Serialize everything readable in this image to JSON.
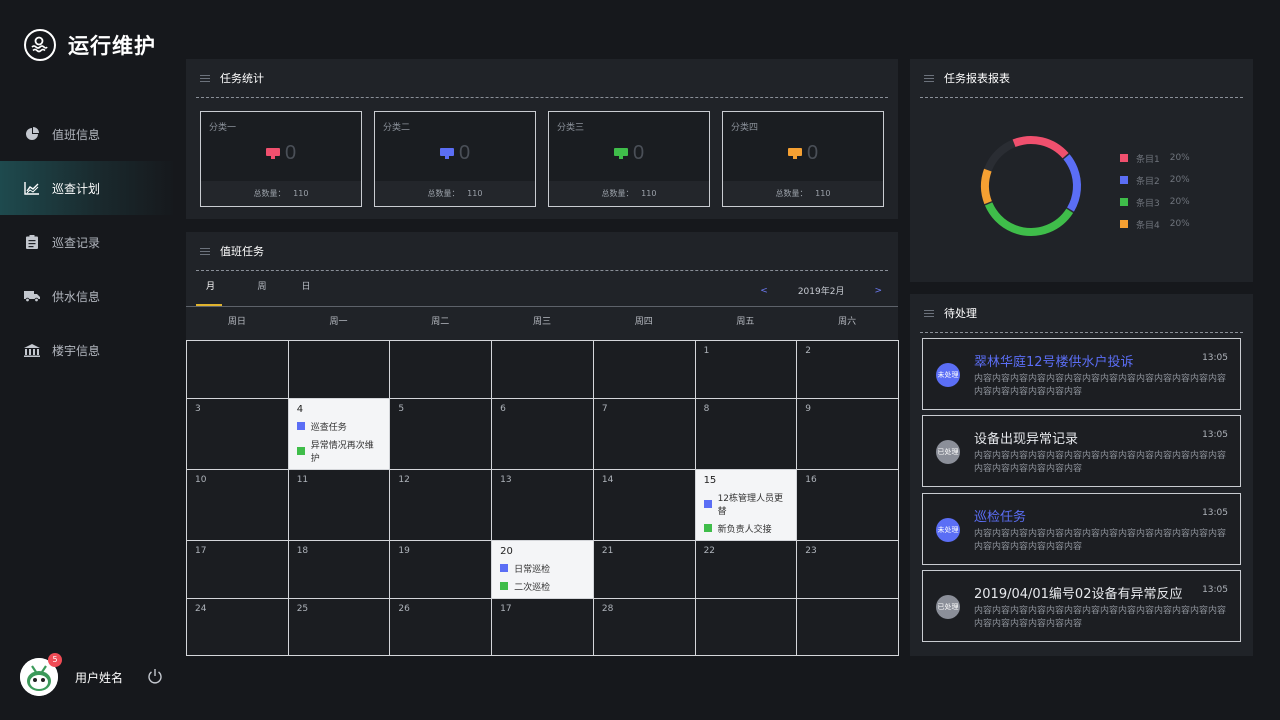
{
  "app": {
    "title": "运行维护"
  },
  "sidebar": {
    "items": [
      {
        "label": "值班信息",
        "icon": "pie-chart-icon",
        "active": false
      },
      {
        "label": "巡查计划",
        "icon": "line-chart-icon",
        "active": true
      },
      {
        "label": "巡查记录",
        "icon": "clipboard-icon",
        "active": false
      },
      {
        "label": "供水信息",
        "icon": "truck-icon",
        "active": false
      },
      {
        "label": "楼宇信息",
        "icon": "building-icon",
        "active": false
      }
    ]
  },
  "user": {
    "name": "用户姓名",
    "badge": "5"
  },
  "task_stats": {
    "title": "任务统计",
    "cards": [
      {
        "category": "分类一",
        "count": "0",
        "total_label": "总数量：",
        "total": "110",
        "color": "#f0506e"
      },
      {
        "category": "分类二",
        "count": "0",
        "total_label": "总数量：",
        "total": "110",
        "color": "#5b6ef5"
      },
      {
        "category": "分类三",
        "count": "0",
        "total_label": "总数量：",
        "total": "110",
        "color": "#3fbd4a"
      },
      {
        "category": "分类四",
        "count": "0",
        "total_label": "总数量：",
        "total": "110",
        "color": "#f5a032"
      }
    ]
  },
  "duty": {
    "title": "值班任务",
    "tabs": [
      "月",
      "周",
      "日"
    ],
    "active_tab": "月",
    "month": "2019年2月",
    "prev": "<",
    "next": ">",
    "weekdays": [
      "周日",
      "周一",
      "周二",
      "周三",
      "周四",
      "周五",
      "周六"
    ],
    "cells": [
      {
        "d": ""
      },
      {
        "d": ""
      },
      {
        "d": ""
      },
      {
        "d": ""
      },
      {
        "d": ""
      },
      {
        "d": "1"
      },
      {
        "d": "2"
      },
      {
        "d": "3"
      },
      {
        "d": "4",
        "events": [
          {
            "text": "巡查任务",
            "color": "#5b6ef5"
          },
          {
            "text": "异常情况再次维护",
            "color": "#3fbd4a"
          }
        ]
      },
      {
        "d": "5"
      },
      {
        "d": "6"
      },
      {
        "d": "7"
      },
      {
        "d": "8"
      },
      {
        "d": "9"
      },
      {
        "d": "10"
      },
      {
        "d": "11"
      },
      {
        "d": "12"
      },
      {
        "d": "13"
      },
      {
        "d": "14"
      },
      {
        "d": "15",
        "events": [
          {
            "text": "12栋管理人员更替",
            "color": "#5b6ef5"
          },
          {
            "text": "新负责人交接",
            "color": "#3fbd4a"
          }
        ]
      },
      {
        "d": "16"
      },
      {
        "d": "17"
      },
      {
        "d": "18"
      },
      {
        "d": "19"
      },
      {
        "d": "20",
        "events": [
          {
            "text": "日常巡检",
            "color": "#5b6ef5"
          },
          {
            "text": "二次巡检",
            "color": "#3fbd4a"
          }
        ]
      },
      {
        "d": "21"
      },
      {
        "d": "22"
      },
      {
        "d": "23"
      },
      {
        "d": "24"
      },
      {
        "d": "25"
      },
      {
        "d": "26"
      },
      {
        "d": "17"
      },
      {
        "d": "28"
      },
      {
        "d": ""
      },
      {
        "d": ""
      }
    ]
  },
  "report": {
    "title": "任务报表报表",
    "chart_data": {
      "type": "pie",
      "categories": [
        "条目1",
        "条目2",
        "条目3",
        "条目4"
      ],
      "values": [
        20,
        20,
        20,
        20
      ],
      "value_labels": [
        "20%",
        "20%",
        "20%",
        "20%"
      ],
      "colors": [
        "#f0506e",
        "#5b6ef5",
        "#3fbd4a",
        "#f5a032"
      ],
      "segments": [
        {
          "label": "条目1",
          "fraction": 0.2
        },
        {
          "label": "条目2",
          "fraction": 0.2
        },
        {
          "label": "条目3",
          "fraction": 0.35
        },
        {
          "label": "条目4",
          "fraction": 0.12
        }
      ],
      "legend_position": "right"
    }
  },
  "pending": {
    "title": "待处理",
    "items": [
      {
        "title": "翠林华庭12号楼供水户投诉",
        "time": "13:05",
        "status": "未处理",
        "unhandled": true,
        "body": "内容内容内容内容内容内容内容内容内容内容内容内容内容内容内容内容内容内容内容内容"
      },
      {
        "title": "设备出现异常记录",
        "time": "13:05",
        "status": "已处理",
        "unhandled": false,
        "body": "内容内容内容内容内容内容内容内容内容内容内容内容内容内容内容内容内容内容内容内容"
      },
      {
        "title": "巡检任务",
        "time": "13:05",
        "status": "未处理",
        "unhandled": true,
        "body": "内容内容内容内容内容内容内容内容内容内容内容内容内容内容内容内容内容内容内容内容"
      },
      {
        "title": "2019/04/01编号02设备有异常反应",
        "time": "13:05",
        "status": "已处理",
        "unhandled": false,
        "body": "内容内容内容内容内容内容内容内容内容内容内容内容内容内容内容内容内容内容内容内容"
      }
    ]
  },
  "colors": {
    "accent": "#5b6ef5",
    "tab_underline": "#e0b32e",
    "handled": "#8b8f99"
  }
}
